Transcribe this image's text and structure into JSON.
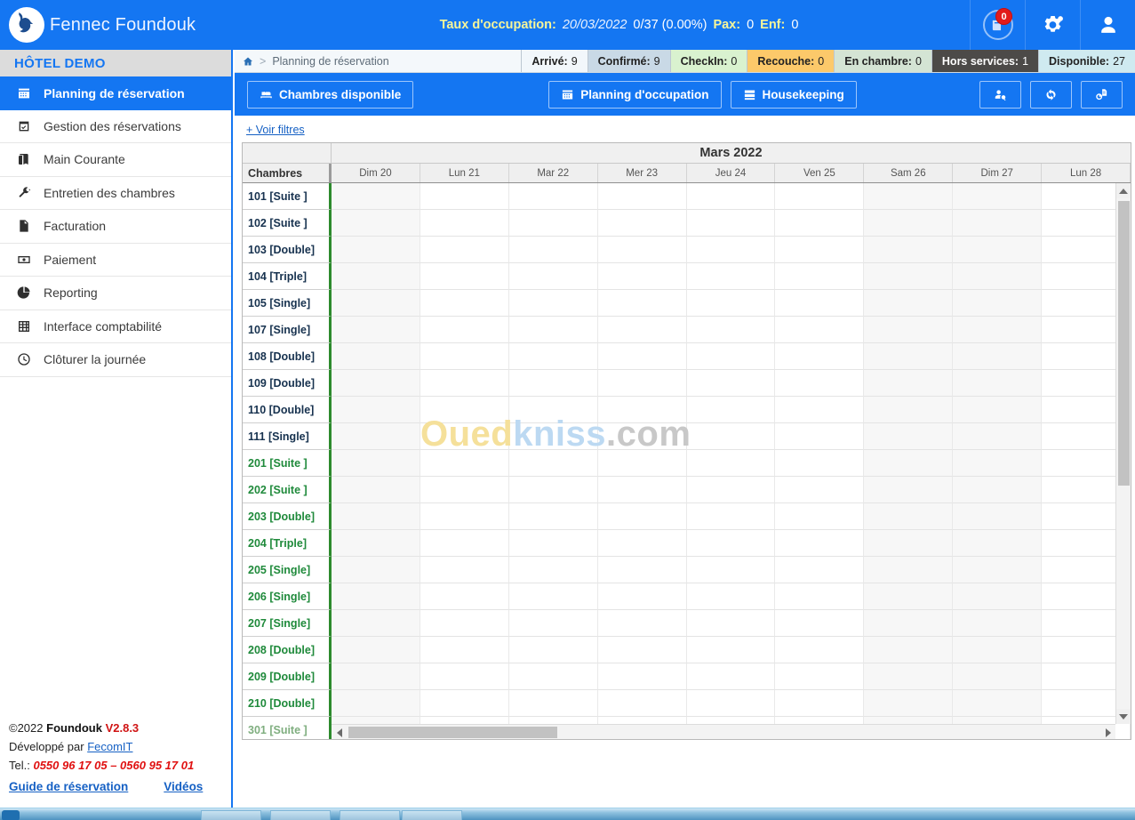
{
  "header": {
    "brand": "Fennec Foundouk",
    "logo_icon": "fennec-logo-icon",
    "occupancy_label": "Taux d'occupation:",
    "occupancy_date": "20/03/2022",
    "occupancy_value": "0/37 (0.00%)",
    "pax_label": "Pax:",
    "pax_value": "0",
    "enf_label": "Enf:",
    "enf_value": "0",
    "notification_badge": "0",
    "icons": {
      "notifications": "book-notification-icon",
      "settings": "gears-icon",
      "user": "user-avatar-icon"
    }
  },
  "sidebar": {
    "hotel": "HÔTEL DEMO",
    "items": [
      {
        "label": "Planning de réservation",
        "icon": "calendar-icon",
        "active": true
      },
      {
        "label": "Gestion des réservations",
        "icon": "calendar-check-icon",
        "active": false
      },
      {
        "label": "Main Courante",
        "icon": "book-icon",
        "active": false
      },
      {
        "label": "Entretien des chambres",
        "icon": "wrench-icon",
        "active": false
      },
      {
        "label": "Facturation",
        "icon": "invoice-icon",
        "active": false
      },
      {
        "label": "Paiement",
        "icon": "money-icon",
        "active": false
      },
      {
        "label": "Reporting",
        "icon": "pie-chart-icon",
        "active": false
      },
      {
        "label": "Interface comptabilité",
        "icon": "table-grid-icon",
        "active": false
      },
      {
        "label": "Clôturer la journée",
        "icon": "clock-icon",
        "active": false
      }
    ],
    "footer": {
      "copyright": "©2022",
      "product": "Foundouk",
      "version": "V2.8.3",
      "developed_by": "Développé par",
      "developer": "FecomIT",
      "tel_label": "Tel.:",
      "tel_value": "0550 96 17 05 – 0560 95 17 01",
      "guide_link": "Guide de réservation",
      "videos_link": "Vidéos"
    }
  },
  "breadcrumb": {
    "home_icon": "home-icon",
    "separator": ">",
    "current": "Planning de réservation"
  },
  "stats": [
    {
      "label": "Arrivé:",
      "value": "9",
      "bg": "#f2f7fb",
      "fg": "#222222"
    },
    {
      "label": "Confirmé:",
      "value": "9",
      "bg": "#c9d9e6",
      "fg": "#222222"
    },
    {
      "label": "CheckIn:",
      "value": "0",
      "bg": "#d9f2cf",
      "fg": "#222222"
    },
    {
      "label": "Recouche:",
      "value": "0",
      "bg": "#fcc96a",
      "fg": "#222222"
    },
    {
      "label": "En chambre:",
      "value": "0",
      "bg": "#d4e4d4",
      "fg": "#222222"
    },
    {
      "label": "Hors services:",
      "value": "1",
      "bg": "#4c4a48",
      "fg": "#ffffff"
    },
    {
      "label": "Disponible:",
      "value": "27",
      "bg": "#cfeaf0",
      "fg": "#222222"
    }
  ],
  "toolbar": {
    "buttons": [
      {
        "label": "Chambres disponible",
        "icon": "bed-icon"
      },
      {
        "label": "Planning d'occupation",
        "icon": "calendar-icon"
      },
      {
        "label": "Housekeeping",
        "icon": "list-icon"
      }
    ],
    "icon_buttons": [
      {
        "icon": "user-search-icon",
        "label": ""
      },
      {
        "icon": "refresh-icon",
        "label": ""
      },
      {
        "icon": "report-print-icon",
        "label": ""
      }
    ]
  },
  "planning": {
    "filters_link": "+ Voir filtres",
    "rooms_header": "Chambres",
    "month": "Mars 2022",
    "days": [
      "Dim 20",
      "Lun 21",
      "Mar 22",
      "Mer 23",
      "Jeu 24",
      "Ven 25",
      "Sam 26",
      "Dim 27",
      "Lun 28"
    ],
    "weekend_indices": [
      0,
      6,
      7
    ],
    "rooms": [
      {
        "label": "101 [Suite ]",
        "floor": 1
      },
      {
        "label": "102 [Suite ]",
        "floor": 1
      },
      {
        "label": "103 [Double]",
        "floor": 1
      },
      {
        "label": "104 [Triple]",
        "floor": 1
      },
      {
        "label": "105 [Single]",
        "floor": 1
      },
      {
        "label": "107 [Single]",
        "floor": 1
      },
      {
        "label": "108 [Double]",
        "floor": 1
      },
      {
        "label": "109 [Double]",
        "floor": 1
      },
      {
        "label": "110 [Double]",
        "floor": 1
      },
      {
        "label": "111 [Single]",
        "floor": 1
      },
      {
        "label": "201 [Suite ]",
        "floor": 2
      },
      {
        "label": "202 [Suite ]",
        "floor": 2
      },
      {
        "label": "203 [Double]",
        "floor": 2
      },
      {
        "label": "204 [Triple]",
        "floor": 2
      },
      {
        "label": "205 [Single]",
        "floor": 2
      },
      {
        "label": "206 [Single]",
        "floor": 2
      },
      {
        "label": "207 [Single]",
        "floor": 2
      },
      {
        "label": "208 [Double]",
        "floor": 2
      },
      {
        "label": "209 [Double]",
        "floor": 2
      },
      {
        "label": "210 [Double]",
        "floor": 2
      },
      {
        "label": "301 [Suite ]",
        "floor": 3
      }
    ],
    "watermark": {
      "part1": "Oued",
      "part2": "kniss",
      "part3": ".com"
    }
  },
  "colors": {
    "primary": "#1476f2",
    "sidebar_head": "#dcdcdc",
    "room_floor1": "#17324f",
    "room_floor2": "#1f8a3b",
    "accent_green": "#2d8a2d",
    "link": "#1560c4",
    "danger": "#d01414"
  }
}
